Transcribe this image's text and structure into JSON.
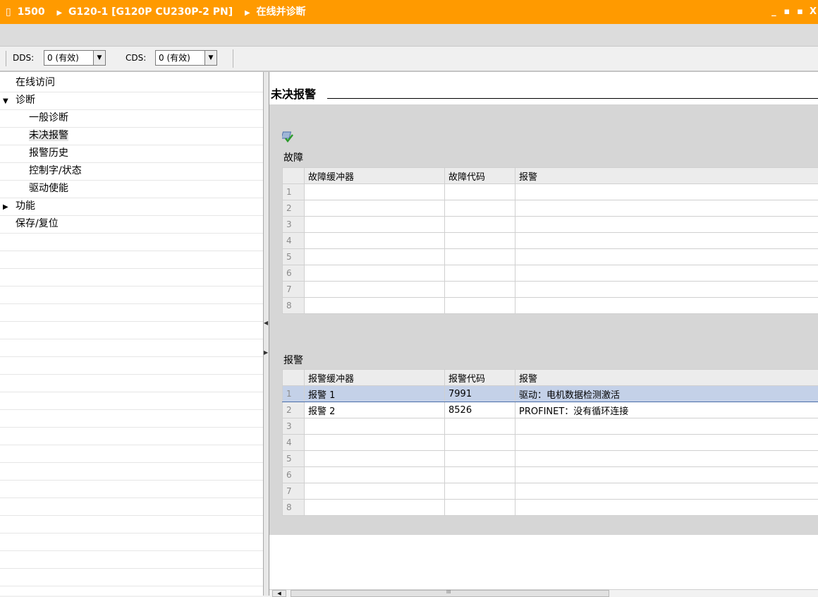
{
  "titlebar": {
    "crumbs": [
      "1500",
      "G120-1 [G120P CU230P-2 PN]",
      "在线并诊断"
    ],
    "controls": [
      "_",
      "▪",
      "▪",
      "X"
    ]
  },
  "toolbar": {
    "dds_label": "DDS:",
    "dds_value": "0 (有效)",
    "cds_label": "CDS:",
    "cds_value": "0 (有效)"
  },
  "nav": {
    "items": [
      {
        "label": "在线访问",
        "level": 0,
        "arrow": ""
      },
      {
        "label": "诊断",
        "level": 0,
        "arrow": "▼"
      },
      {
        "label": "一般诊断",
        "level": 1,
        "arrow": ""
      },
      {
        "label": "未决报警",
        "level": 1,
        "arrow": "",
        "selected": true
      },
      {
        "label": "报警历史",
        "level": 1,
        "arrow": ""
      },
      {
        "label": "控制字/状态",
        "level": 1,
        "arrow": ""
      },
      {
        "label": "驱动使能",
        "level": 1,
        "arrow": ""
      },
      {
        "label": "功能",
        "level": 0,
        "arrow": "▶"
      },
      {
        "label": "保存/复位",
        "level": 0,
        "arrow": ""
      }
    ]
  },
  "main": {
    "title": "未决报警",
    "faults": {
      "label": "故障",
      "columns": [
        "故障缓冲器",
        "故障代码",
        "报警"
      ],
      "rows": [
        [
          "1",
          "",
          "",
          ""
        ],
        [
          "2",
          "",
          "",
          ""
        ],
        [
          "3",
          "",
          "",
          ""
        ],
        [
          "4",
          "",
          "",
          ""
        ],
        [
          "5",
          "",
          "",
          ""
        ],
        [
          "6",
          "",
          "",
          ""
        ],
        [
          "7",
          "",
          "",
          ""
        ],
        [
          "8",
          "",
          "",
          ""
        ]
      ]
    },
    "alarms": {
      "label": "报警",
      "columns": [
        "报警缓冲器",
        "报警代码",
        "报警"
      ],
      "rows": [
        [
          "1",
          "报警 1",
          "7991",
          "驱动：电机数据检测激活"
        ],
        [
          "2",
          "报警 2",
          "8526",
          "PROFINET：没有循环连接"
        ],
        [
          "3",
          "",
          "",
          ""
        ],
        [
          "4",
          "",
          "",
          ""
        ],
        [
          "5",
          "",
          "",
          ""
        ],
        [
          "6",
          "",
          "",
          ""
        ],
        [
          "7",
          "",
          "",
          ""
        ],
        [
          "8",
          "",
          "",
          ""
        ]
      ]
    }
  },
  "scrollbar": {
    "grip": "III"
  }
}
